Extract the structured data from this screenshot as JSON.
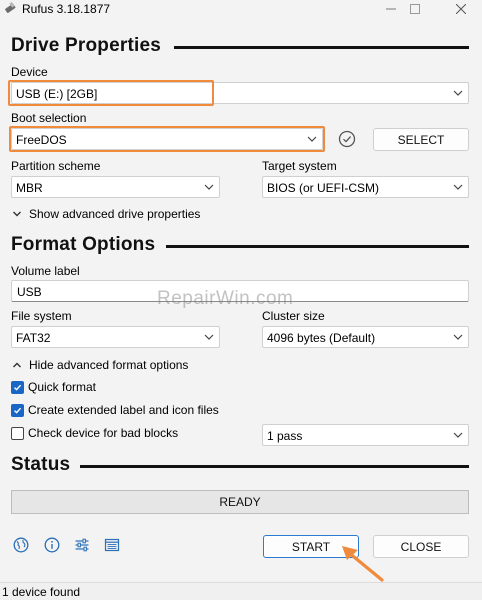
{
  "window": {
    "title": "Rufus 3.18.1877"
  },
  "drive_properties": {
    "heading": "Drive Properties",
    "device_label": "Device",
    "device_value": "USB (E:) [2GB]",
    "boot_selection_label": "Boot selection",
    "boot_selection_value": "FreeDOS",
    "select_button": "SELECT",
    "partition_scheme_label": "Partition scheme",
    "partition_scheme_value": "MBR",
    "target_system_label": "Target system",
    "target_system_value": "BIOS (or UEFI-CSM)",
    "advanced_toggle": "Show advanced drive properties"
  },
  "format_options": {
    "heading": "Format Options",
    "volume_label_label": "Volume label",
    "volume_label_value": "USB",
    "file_system_label": "File system",
    "file_system_value": "FAT32",
    "cluster_size_label": "Cluster size",
    "cluster_size_value": "4096 bytes (Default)",
    "advanced_toggle": "Hide advanced format options",
    "quick_format": {
      "label": "Quick format",
      "checked": true
    },
    "extended_label": {
      "label": "Create extended label and icon files",
      "checked": true
    },
    "bad_blocks": {
      "label": "Check device for bad blocks",
      "checked": false
    },
    "passes_value": "1 pass"
  },
  "status": {
    "heading": "Status",
    "progress_text": "READY"
  },
  "actions": {
    "start": "START",
    "close": "CLOSE"
  },
  "toolbar_icons": [
    "globe-icon",
    "info-icon",
    "settings-sliders-icon",
    "log-icon"
  ],
  "statusbar": {
    "text": "1 device found"
  },
  "watermark": {
    "text": "RepairWin.com"
  },
  "colors": {
    "highlight": "#f08a3c",
    "accent": "#1a66c4",
    "start_border": "#2a7bd1"
  }
}
